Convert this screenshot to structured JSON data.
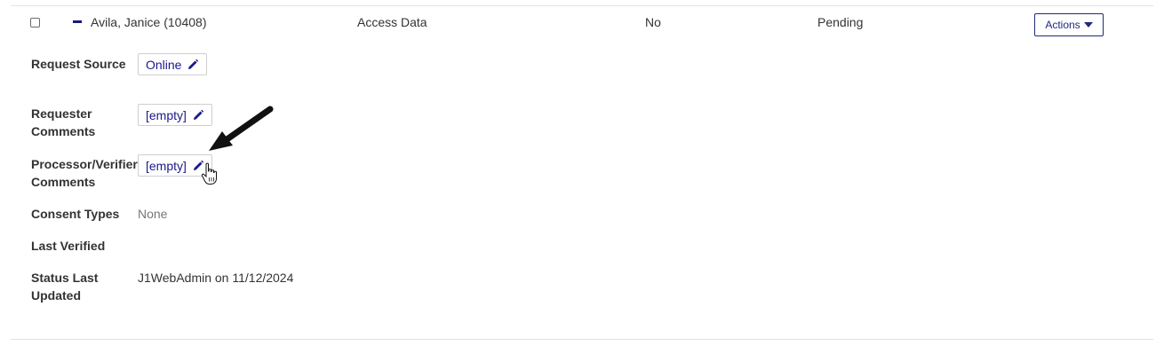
{
  "row": {
    "name": "Avila, Janice (10408)",
    "request_type": "Access Data",
    "flag": "No",
    "status": "Pending",
    "actions_label": "Actions"
  },
  "details": {
    "request_source": {
      "label": "Request Source",
      "value": "Online"
    },
    "requester_comments": {
      "label_line1": "Requester",
      "label_line2": "Comments",
      "value": "[empty]"
    },
    "processor_comments": {
      "label_line1": "Processor/Verifier",
      "label_line2": "Comments",
      "value": "[empty]"
    },
    "consent_types": {
      "label": "Consent Types",
      "value": "None"
    },
    "last_verified": {
      "label": "Last Verified",
      "value": ""
    },
    "status_last_updated": {
      "label_line1": "Status Last",
      "label_line2": "Updated",
      "value": "J1WebAdmin on 11/12/2024"
    }
  },
  "icons": {
    "row_toggle": "minus-icon",
    "edit": "pencil-icon",
    "pointer": "arrow-annotation",
    "cursor": "hand-cursor-icon"
  },
  "colors": {
    "link": "#1a1a8a",
    "accent": "#1f2a7a"
  }
}
